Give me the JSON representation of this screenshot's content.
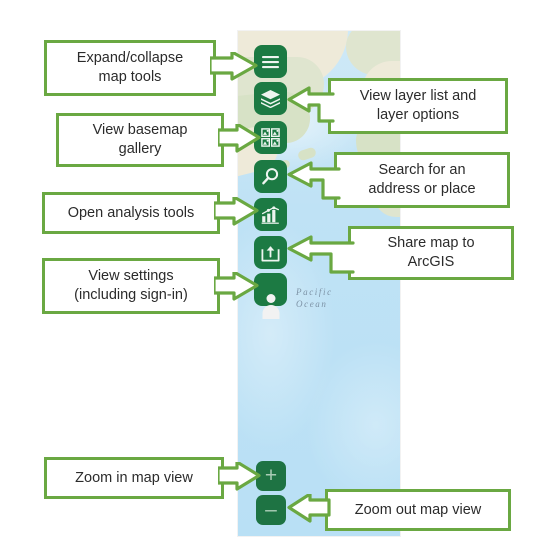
{
  "map": {
    "label_pacific_ocean": "Pacific\nOcean",
    "water_color": "#bfe2f5",
    "land_color": "#e9e4d2",
    "panel_name": "map-view"
  },
  "toolbar": {
    "accent_color": "#1c7a43",
    "buttons": [
      {
        "id": "expand-collapse",
        "icon": "hamburger-menu-icon",
        "tooltip": "Expand/collapse map tools"
      },
      {
        "id": "layer-list",
        "icon": "layers-icon",
        "tooltip": "View layer list and layer options"
      },
      {
        "id": "basemap-gallery",
        "icon": "basemap-grid-icon",
        "tooltip": "View basemap gallery"
      },
      {
        "id": "search",
        "icon": "magnifier-icon",
        "tooltip": "Search for an address or place"
      },
      {
        "id": "analysis",
        "icon": "bar-chart-icon",
        "tooltip": "Open analysis tools"
      },
      {
        "id": "share",
        "icon": "share-arrow-icon",
        "tooltip": "Share map to ArcGIS"
      },
      {
        "id": "settings",
        "icon": "user-avatar-icon",
        "tooltip": "View settings (including sign-in)"
      }
    ],
    "zoom_in_label": "+",
    "zoom_out_label": "–"
  },
  "callouts": {
    "border_color": "#6aa842",
    "expand_collapse": "Expand/collapse\nmap tools",
    "layer_list": "View layer list and\nlayer options",
    "basemap_gallery": "View basemap\ngallery",
    "search": "Search for an\naddress or place",
    "analysis": "Open analysis tools",
    "share": "Share map to\nArcGIS",
    "settings": "View settings\n(including sign-in)",
    "zoom_in": "Zoom in map view",
    "zoom_out": "Zoom out map view"
  }
}
